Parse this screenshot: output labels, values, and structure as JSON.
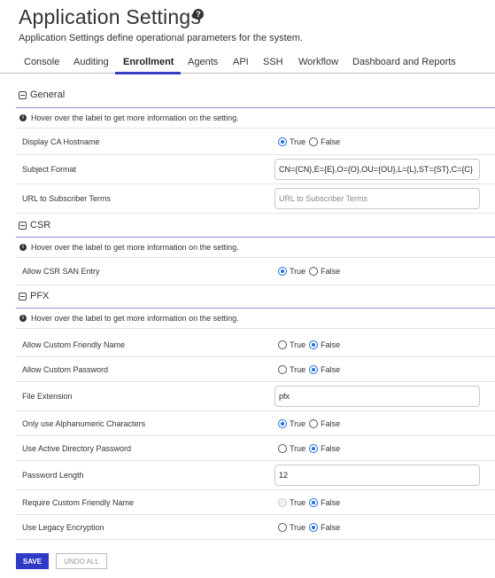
{
  "header": {
    "title": "Application Settings",
    "subtitle": "Application Settings define operational parameters for the system."
  },
  "tabs": [
    {
      "label": "Console"
    },
    {
      "label": "Auditing"
    },
    {
      "label": "Enrollment",
      "active": true
    },
    {
      "label": "Agents"
    },
    {
      "label": "API"
    },
    {
      "label": "SSH"
    },
    {
      "label": "Workflow"
    },
    {
      "label": "Dashboard and Reports"
    }
  ],
  "info_text": "Hover over the label to get more information on the setting.",
  "radio_labels": {
    "true": "True",
    "false": "False"
  },
  "sections": {
    "general": {
      "title": "General",
      "settings": {
        "display_ca_hostname": {
          "label": "Display CA Hostname",
          "value": "True"
        },
        "subject_format": {
          "label": "Subject Format",
          "value": "CN={CN},E={E},O={O},OU={OU},L={L},ST={ST},C={C}"
        },
        "subscriber_terms": {
          "label": "URL to Subscriber Terms",
          "value": "",
          "placeholder": "URL to Subscriber Terms"
        }
      }
    },
    "csr": {
      "title": "CSR",
      "settings": {
        "allow_csr_san": {
          "label": "Allow CSR SAN Entry",
          "value": "True"
        }
      }
    },
    "pfx": {
      "title": "PFX",
      "settings": {
        "custom_friendly_name": {
          "label": "Allow Custom Friendly Name",
          "value": "False"
        },
        "custom_password": {
          "label": "Allow Custom Password",
          "value": "False"
        },
        "file_extension": {
          "label": "File Extension",
          "value": "pfx"
        },
        "alphanumeric": {
          "label": "Only use Alphanumeric Characters",
          "value": "True"
        },
        "ad_password": {
          "label": "Use Active Directory Password",
          "value": "False"
        },
        "password_length": {
          "label": "Password Length",
          "value": "12"
        },
        "require_friendly_name": {
          "label": "Require Custom Friendly Name",
          "value": "False",
          "true_disabled": true
        },
        "legacy_encryption": {
          "label": "Use Legacy Encryption",
          "value": "False"
        }
      }
    }
  },
  "actions": {
    "save": "SAVE",
    "undo_all": "UNDO ALL"
  },
  "colors": {
    "accent": "#3a3fc8",
    "radio_checked": "#1f6fe0",
    "section_line": "#8f91d6",
    "save_button": "#2f3bc6"
  }
}
